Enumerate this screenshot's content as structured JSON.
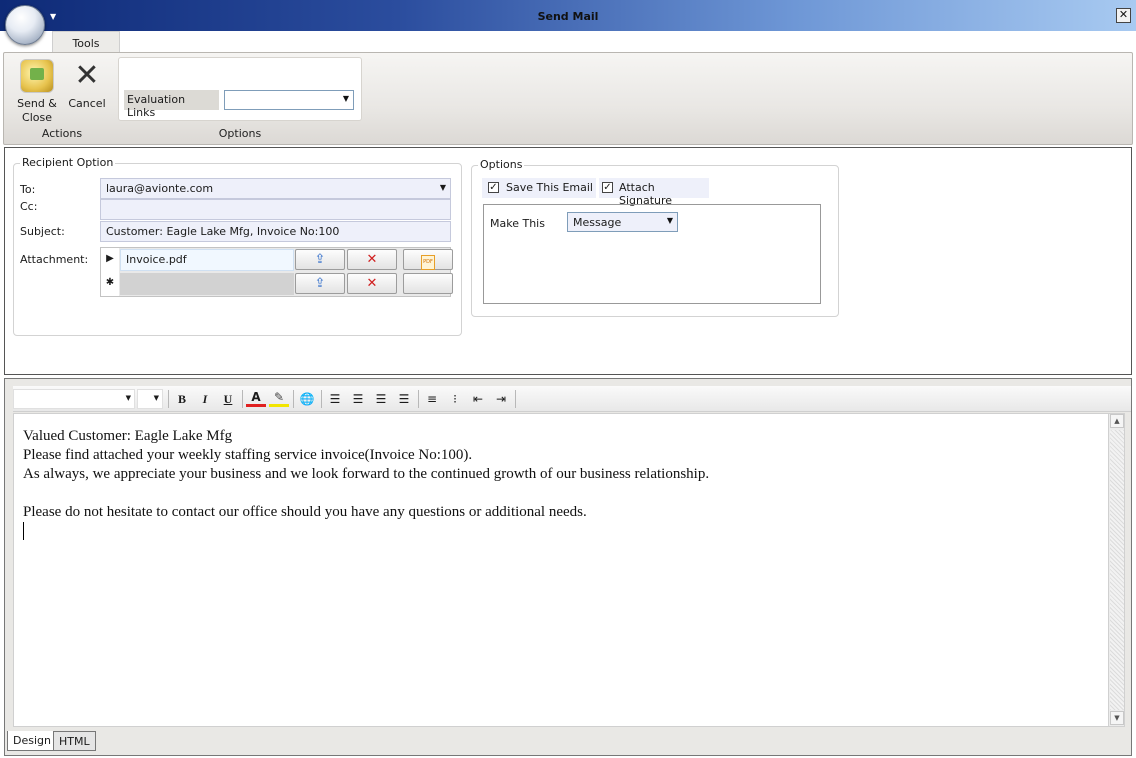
{
  "window": {
    "title": "Send Mail",
    "close_symbol": "✕"
  },
  "ribbon": {
    "tab_label": "Tools",
    "actions": {
      "group_label": "Actions",
      "send_close_label_line1": "Send &",
      "send_close_label_line2": "Close",
      "cancel_label": "Cancel"
    },
    "options": {
      "group_label": "Options",
      "evaluation_links_label": "Evaluation Links",
      "evaluation_links_value": ""
    }
  },
  "recipient": {
    "legend": "Recipient Option",
    "to_label": "To:",
    "to_value": "laura@avionte.com",
    "cc_label": "Cc:",
    "cc_value": "",
    "subject_label": "Subject:",
    "subject_value": "Customer: Eagle Lake Mfg, Invoice No:100",
    "attachment_label": "Attachment:",
    "attachments": [
      {
        "row_marker": "▶",
        "filename": "Invoice.pdf"
      },
      {
        "row_marker": "✱",
        "filename": ""
      }
    ],
    "pdf_icon_text": "PDF"
  },
  "options": {
    "legend": "Options",
    "save_email_label": "Save This Email",
    "save_email_checked": true,
    "attach_signature_label": "Attach Signature",
    "attach_signature_checked": true,
    "make_this_label": "Make This",
    "make_this_value": "Message"
  },
  "editor": {
    "font_name": "",
    "font_size": "",
    "toolbar": {
      "bold": "B",
      "italic": "I",
      "underline": "U",
      "font_color": "A"
    },
    "body_lines": [
      "Valued Customer: Eagle Lake Mfg",
      "Please find attached your weekly staffing service invoice(Invoice No:100).",
      "As always, we appreciate your business and we look forward to the continued growth of our business relationship.",
      "",
      "Please do not hesitate to contact our office should you have any questions or additional needs."
    ],
    "tabs": [
      "Design",
      "HTML"
    ],
    "active_tab": "Design"
  },
  "colors": {
    "title_gradient_start": "#0e2a77",
    "title_gradient_end": "#a8caf1",
    "input_background": "#eef0fa",
    "font_color_underline": "#e02020",
    "highlight_underline": "#f2e500"
  }
}
